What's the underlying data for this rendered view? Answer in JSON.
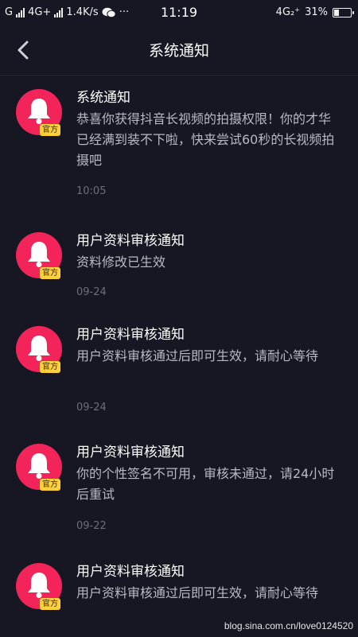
{
  "status_bar": {
    "carrier_left": "G",
    "network_left": "4G+",
    "speed": "1.4K/s",
    "dots": "···",
    "time": "11:19",
    "network_right": "4G₂⁺",
    "battery_percent": "31%",
    "battery_level": 0.31
  },
  "header": {
    "title": "系统通知",
    "back_icon": "chevron-left-icon"
  },
  "notifications": [
    {
      "title": "系统通知",
      "body": "恭喜你获得抖音长视频的拍摄权限！你的才华已经满到装不下啦，快来尝试60秒的长视频拍摄吧",
      "time": "10:05",
      "badge": "官方",
      "icon": "bell-icon"
    },
    {
      "title": "用户资料审核通知",
      "body": "资料修改已生效",
      "time": "09-24",
      "badge": "官方",
      "icon": "bell-icon"
    },
    {
      "title": "用户资料审核通知",
      "body": "用户资料审核通过后即可生效，请耐心等待",
      "time": "09-24",
      "badge": "官方",
      "icon": "bell-icon"
    },
    {
      "title": "用户资料审核通知",
      "body": "你的个性签名不可用，审核未通过，请24小时后重试",
      "time": "09-22",
      "badge": "官方",
      "icon": "bell-icon"
    },
    {
      "title": "用户资料审核通知",
      "body": "用户资料审核通过后即可生效，请耐心等待",
      "time": "",
      "badge": "官方",
      "icon": "bell-icon"
    }
  ],
  "watermark": "blog.sina.com.cn/love0124520",
  "colors": {
    "background": "#171723",
    "accent": "#f2245a",
    "badge": "#ffd03a",
    "body_text": "#b9b9c4",
    "time_text": "#6e6e7a"
  }
}
